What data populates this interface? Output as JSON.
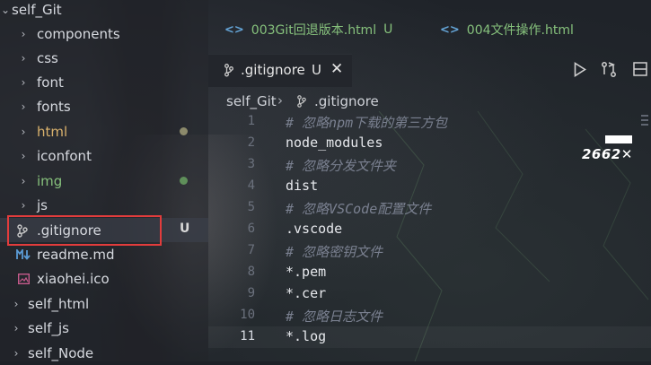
{
  "sidebar": {
    "items": [
      {
        "label": "self_Git",
        "type": "folder-open",
        "color": "#d7dae0"
      },
      {
        "label": "components",
        "type": "folder",
        "color": "#d7dae0"
      },
      {
        "label": "css",
        "type": "folder",
        "color": "#d7dae0"
      },
      {
        "label": "font",
        "type": "folder",
        "color": "#d7dae0"
      },
      {
        "label": "fonts",
        "type": "folder",
        "color": "#d7dae0"
      },
      {
        "label": "html",
        "type": "folder",
        "color": "#d8b16c"
      },
      {
        "label": "iconfont",
        "type": "folder",
        "color": "#d7dae0"
      },
      {
        "label": "img",
        "type": "folder",
        "color": "#86c17c"
      },
      {
        "label": "js",
        "type": "folder",
        "color": "#d7dae0"
      },
      {
        "label": ".gitignore",
        "type": "file",
        "badge": "U",
        "color": "#d7dae0"
      },
      {
        "label": "readme.md",
        "type": "file",
        "color": "#d7dae0"
      },
      {
        "label": "xiaohei.ico",
        "type": "file",
        "color": "#d7dae0"
      },
      {
        "label": "self_html",
        "type": "folder",
        "color": "#d7dae0"
      },
      {
        "label": "self_js",
        "type": "folder",
        "color": "#d7dae0"
      },
      {
        "label": "self_Node",
        "type": "folder",
        "color": "#d7dae0"
      }
    ]
  },
  "tabs": {
    "open_files": [
      {
        "label": "003Git回退版本.html",
        "status": "U"
      },
      {
        "label": "004文件操作.html",
        "status": ""
      }
    ],
    "active": {
      "label": ".gitignore",
      "status": "U"
    }
  },
  "breadcrumb": {
    "root": "self_Git",
    "file": ".gitignore"
  },
  "editor": {
    "lines": [
      {
        "n": "1",
        "text": "# 忽略npm下载的第三方包",
        "kind": "comment"
      },
      {
        "n": "2",
        "text": "node_modules",
        "kind": "text"
      },
      {
        "n": "3",
        "text": "# 忽略分发文件夹",
        "kind": "comment"
      },
      {
        "n": "4",
        "text": "dist",
        "kind": "text"
      },
      {
        "n": "5",
        "text": "# 忽略VSCode配置文件",
        "kind": "comment"
      },
      {
        "n": "6",
        "text": ".vscode",
        "kind": "text"
      },
      {
        "n": "7",
        "text": "# 忽略密钥文件",
        "kind": "comment"
      },
      {
        "n": "8",
        "text": "*.pem",
        "kind": "text"
      },
      {
        "n": "9",
        "text": "*.cer",
        "kind": "text"
      },
      {
        "n": "10",
        "text": "# 忽略日志文件",
        "kind": "comment"
      },
      {
        "n": "11",
        "text": "*.log",
        "kind": "text"
      }
    ],
    "current_line": "11"
  },
  "overlay": {
    "text": "2662✕"
  },
  "colors": {
    "accent_green": "#86c17c",
    "html_yellow": "#d8b16c",
    "highlight_red": "#e23c3c"
  },
  "icons": {
    "tab_icon": "html-code-icon",
    "git_file": "git-file-icon",
    "run": "play-icon",
    "diff": "compare-icon",
    "split": "split-editor-icon",
    "close": "close-icon"
  }
}
